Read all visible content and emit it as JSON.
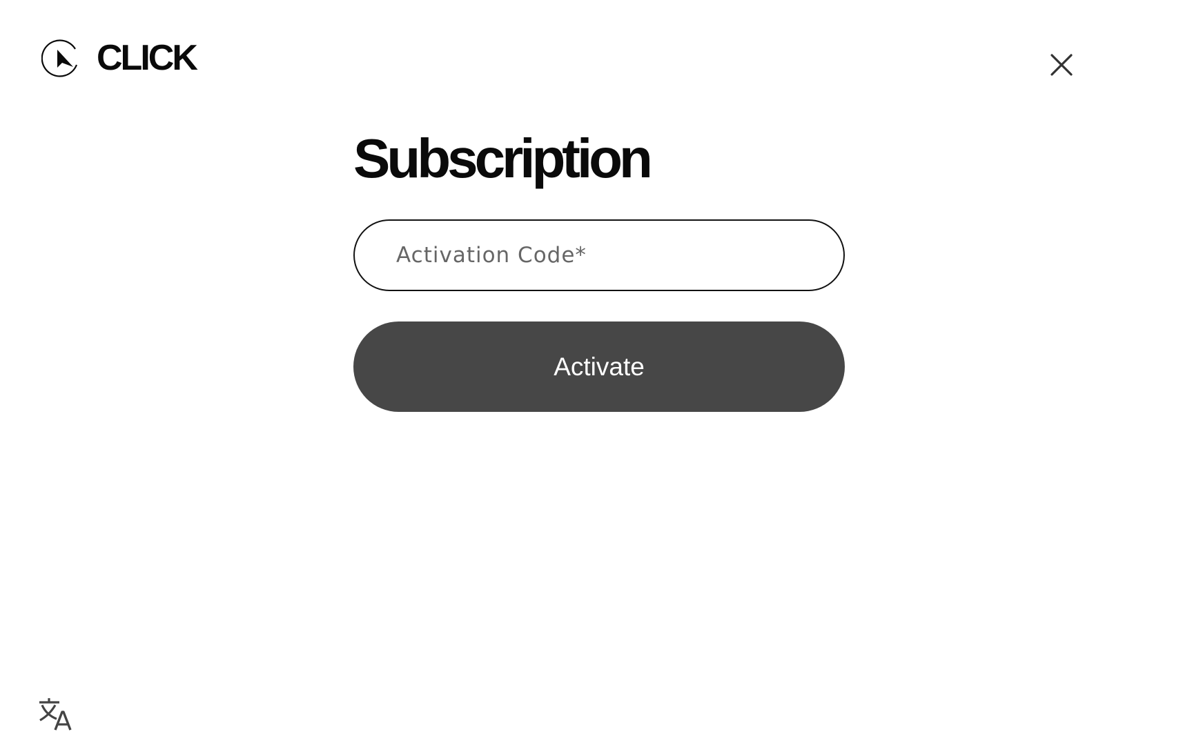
{
  "brand": {
    "name": "CLICK",
    "icon": "play-cursor-circle-icon"
  },
  "header": {
    "close_icon": "close-icon"
  },
  "main": {
    "title": "Subscription",
    "activation_field": {
      "placeholder": "Activation Code*",
      "value": ""
    },
    "activate_label": "Activate"
  },
  "footer": {
    "language_icon": "translate-icon"
  },
  "colors": {
    "button_bg": "#474747",
    "button_text": "#ffffff",
    "text_primary": "#0a0a0a",
    "placeholder": "#666666",
    "background": "#ffffff"
  }
}
